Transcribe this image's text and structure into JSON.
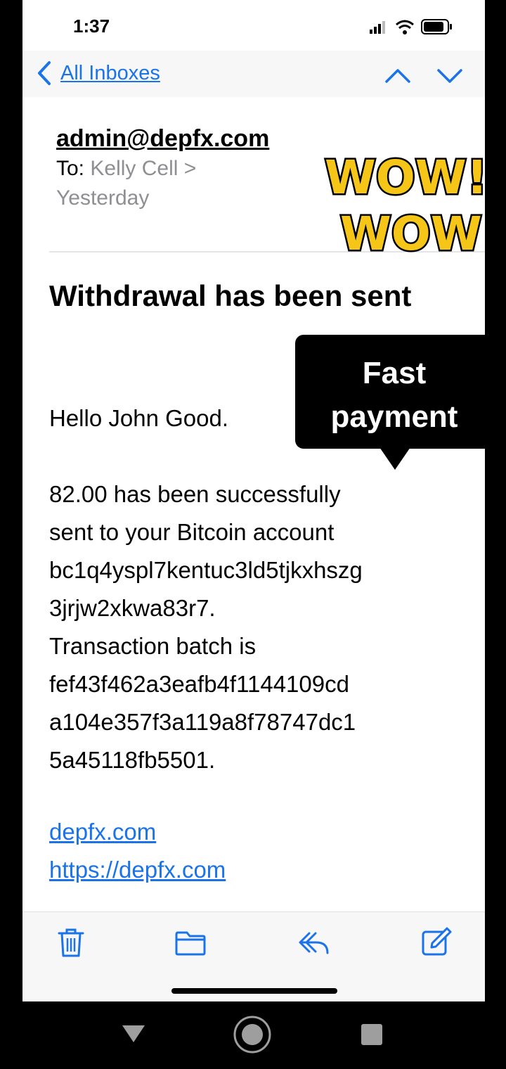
{
  "status_bar": {
    "time": "1:37"
  },
  "nav": {
    "back_label": "All Inboxes"
  },
  "email": {
    "from": "admin@depfx.com",
    "to_prefix": "To:",
    "to_name": "Kelly Cell >",
    "date": "Yesterday",
    "subject": "Withdrawal has been sent",
    "greeting": "Hello John Good.",
    "body_lines": [
      "82.00 has been successfully",
      "sent to your Bitcoin account",
      "bc1q4yspl7kentuc3ld5tjkxhszg",
      "3jrjw2xkwa83r7.",
      "Transaction batch is",
      "fef43f462a3eafb4f1144109cd",
      "a104e357f3a119a8f78747dc1",
      "5a45118fb5501."
    ],
    "links": [
      "depfx.com",
      "https://depfx.com"
    ]
  },
  "overlay": {
    "sticker_line1": "WOW!",
    "sticker_line2": "WOW!",
    "bubble_line1": "Fast",
    "bubble_line2": "payment"
  },
  "toolbar": {
    "icons": [
      "trash-icon",
      "folder-icon",
      "reply-icon",
      "compose-icon"
    ]
  },
  "colors": {
    "accent": "#1a73e8",
    "sticker_fill": "#f5c518",
    "sticker_outline": "#000000"
  }
}
